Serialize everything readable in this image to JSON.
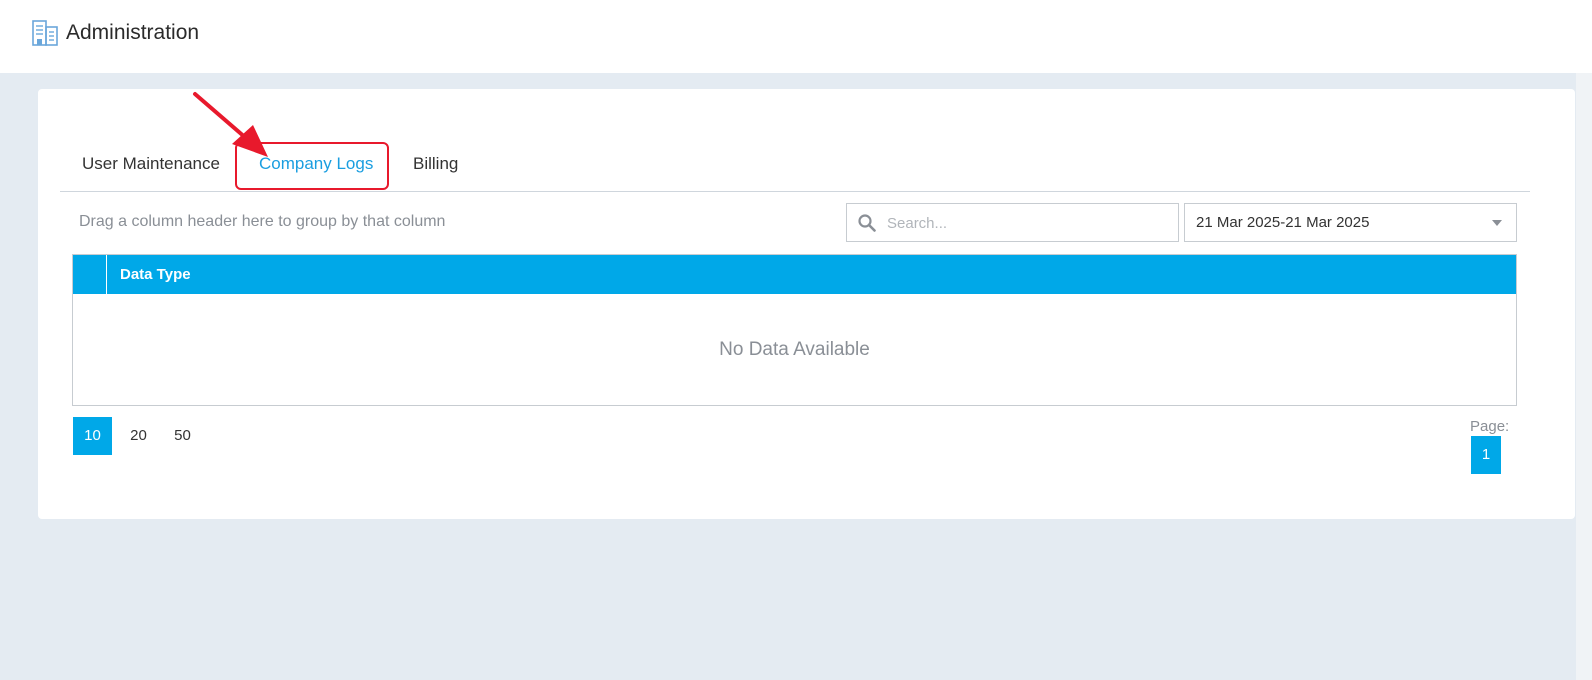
{
  "header": {
    "title": "Administration",
    "icon": "building-document-icon"
  },
  "tabs": [
    {
      "label": "User Maintenance",
      "active": false
    },
    {
      "label": "Company Logs",
      "active": true
    },
    {
      "label": "Billing",
      "active": false
    }
  ],
  "toolbar": {
    "group_hint": "Drag a column header here to group by that column",
    "search_placeholder": "Search...",
    "search_value": "",
    "date_range": "21 Mar 2025-21 Mar 2025"
  },
  "grid": {
    "columns": [
      "Data Type"
    ],
    "empty_text": "No Data Available"
  },
  "pager": {
    "page_sizes": [
      "10",
      "20",
      "50"
    ],
    "selected_page_size": "10",
    "page_label": "Page:",
    "current_page": "1"
  },
  "colors": {
    "accent": "#00a8e8",
    "highlight": "#e8192c",
    "active_tab": "#1a9ee0"
  }
}
